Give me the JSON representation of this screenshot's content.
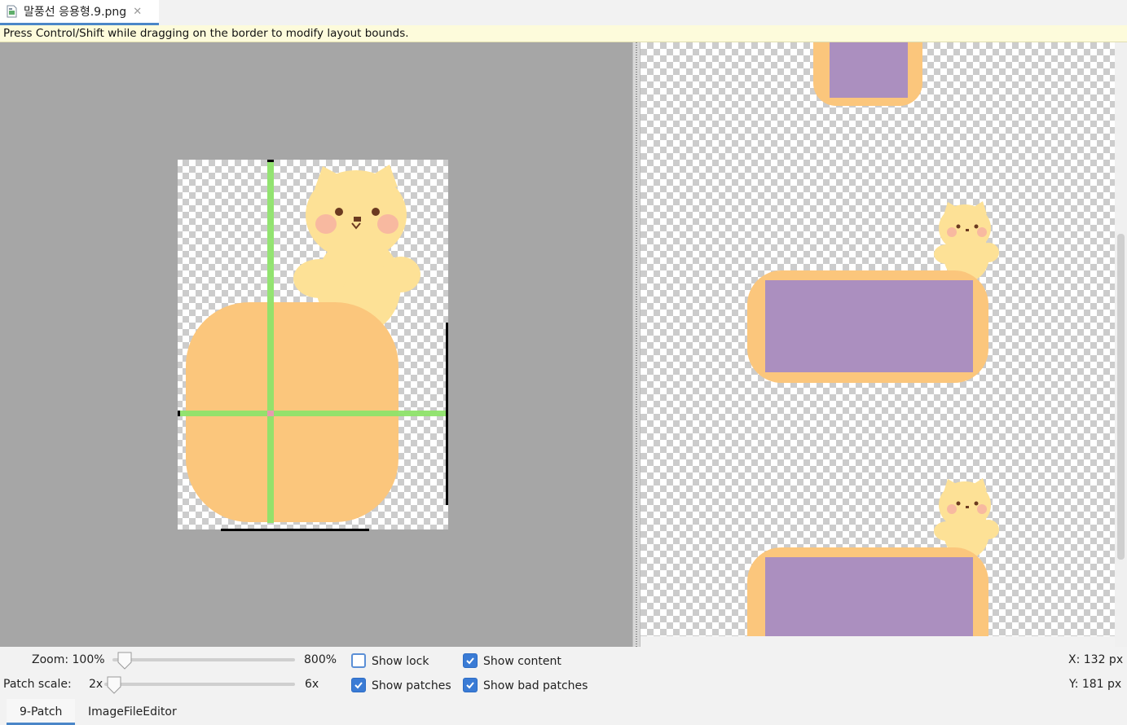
{
  "tab": {
    "filename": "말풍선 응용형.9.png",
    "close_glyph": "✕",
    "icon": "image-file-icon"
  },
  "hint": "Press Control/Shift while dragging on the border to modify layout bounds.",
  "controls": {
    "zoom_label": "Zoom: 100%",
    "zoom_max": "800%",
    "zoom_value_percent": 100,
    "patch_scale_label": "Patch scale:",
    "patch_scale_min": "2x",
    "patch_scale_max": "6x",
    "patch_scale_value": 2,
    "show_lock": {
      "label": "Show lock",
      "checked": false
    },
    "show_content": {
      "label": "Show content",
      "checked": true
    },
    "show_patches": {
      "label": "Show patches",
      "checked": true
    },
    "show_bad_patches": {
      "label": "Show bad patches",
      "checked": true
    },
    "x_readout": "X: 132 px",
    "y_readout": "Y: 181 px"
  },
  "bottom_tabs": [
    {
      "label": "9-Patch",
      "active": true
    },
    {
      "label": "ImageFileEditor",
      "active": false
    }
  ],
  "colors": {
    "patch_guide": "#8ee36a",
    "bubble": "#fbc67c",
    "content": "#ab8fbf",
    "bear": "#fde196",
    "accent": "#4a86c8"
  }
}
